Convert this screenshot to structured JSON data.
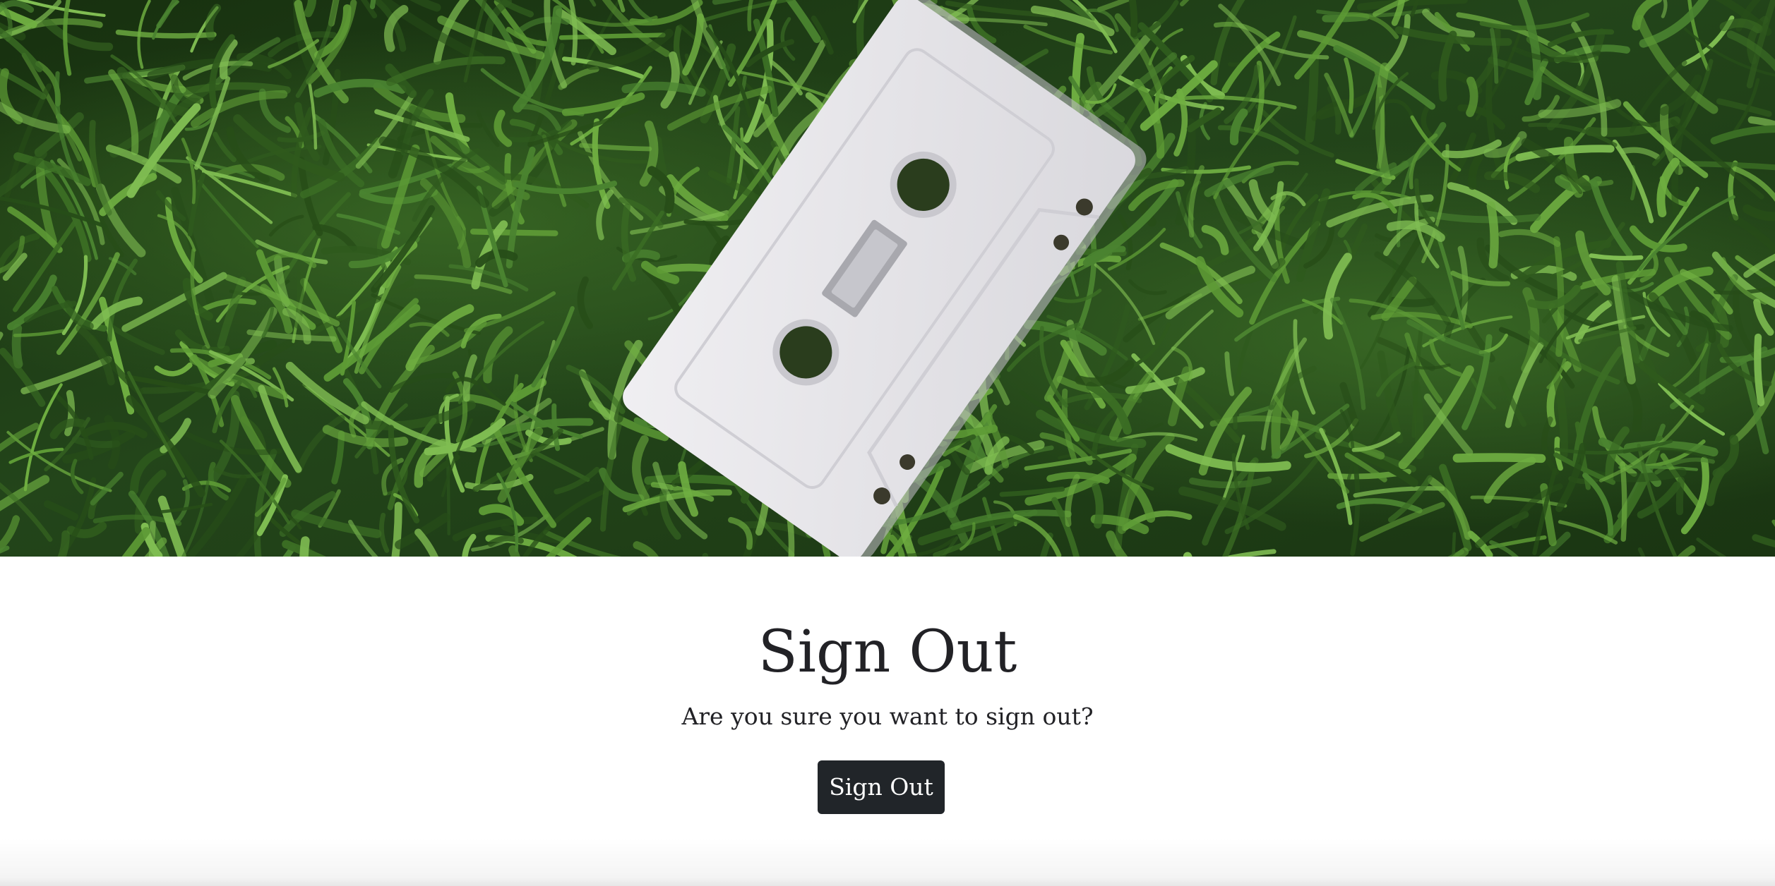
{
  "hero": {
    "image": "cassette-tape-on-grass"
  },
  "signout": {
    "title": "Sign Out",
    "message": "Are you sure you want to sign out?",
    "button_label": "Sign Out"
  },
  "colors": {
    "text": "#222226",
    "button_bg": "#212529",
    "button_text": "#ffffff",
    "grass_dark": "#1f3d15",
    "grass_light": "#5d9a35",
    "cassette": "#e7e6ea"
  }
}
